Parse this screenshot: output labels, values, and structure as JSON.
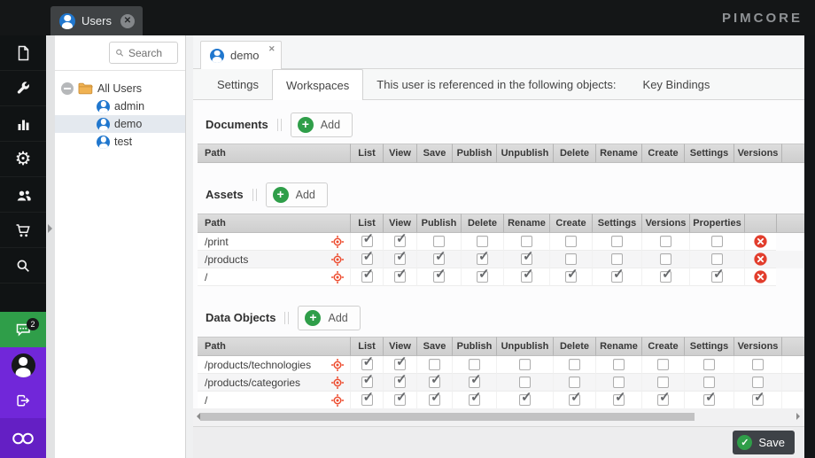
{
  "topbar": {
    "window_tab": {
      "label": "Users"
    },
    "logo_text": "PIMCORE"
  },
  "sidebar": {
    "top_items": [
      {
        "name": "documents",
        "icon": "file-icon"
      },
      {
        "name": "tools",
        "icon": "wrench-icon"
      },
      {
        "name": "reports",
        "icon": "bar-chart-icon"
      },
      {
        "name": "settings",
        "icon": "gear-icon"
      },
      {
        "name": "users",
        "icon": "users-icon"
      },
      {
        "name": "ecommerce",
        "icon": "cart-icon"
      },
      {
        "name": "search",
        "icon": "search-icon"
      }
    ],
    "bottom_items": [
      {
        "name": "notifications",
        "icon": "chat-icon",
        "badge": "2",
        "color": "#2f9e49"
      },
      {
        "name": "account",
        "icon": "user-icon",
        "color": "#7127d9"
      },
      {
        "name": "logout",
        "icon": "logout-icon",
        "color": "#7127d9"
      },
      {
        "name": "pimcore",
        "icon": "infinity-icon",
        "color": "#641fc4"
      }
    ]
  },
  "tree": {
    "search_placeholder": "Search",
    "root_label": "All Users",
    "users": [
      "admin",
      "demo",
      "test"
    ],
    "selected_user": "demo"
  },
  "main": {
    "object_tab": {
      "label": "demo"
    },
    "subtabs": [
      {
        "label": "Settings",
        "active": false
      },
      {
        "label": "Workspaces",
        "active": true
      },
      {
        "label": "This user is referenced in the following objects:",
        "active": false
      },
      {
        "label": "Key Bindings",
        "active": false
      }
    ],
    "sections": [
      {
        "title": "Documents",
        "add_label": "Add",
        "columns": [
          "Path",
          "List",
          "View",
          "Save",
          "Publish",
          "Unpublish",
          "Delete",
          "Rename",
          "Create",
          "Settings",
          "Versions"
        ],
        "row_delete_button": false,
        "rows": []
      },
      {
        "title": "Assets",
        "add_label": "Add",
        "columns": [
          "Path",
          "List",
          "View",
          "Publish",
          "Delete",
          "Rename",
          "Create",
          "Settings",
          "Versions",
          "Properties"
        ],
        "row_delete_button": true,
        "rows": [
          {
            "path": "/print",
            "checks": [
              true,
              true,
              false,
              false,
              false,
              false,
              false,
              false,
              false
            ]
          },
          {
            "path": "/products",
            "checks": [
              true,
              true,
              true,
              true,
              true,
              false,
              false,
              false,
              false
            ]
          },
          {
            "path": "/",
            "checks": [
              true,
              true,
              true,
              true,
              true,
              true,
              true,
              true,
              true
            ]
          }
        ]
      },
      {
        "title": "Data Objects",
        "add_label": "Add",
        "columns": [
          "Path",
          "List",
          "View",
          "Save",
          "Publish",
          "Unpublish",
          "Delete",
          "Rename",
          "Create",
          "Settings",
          "Versions"
        ],
        "row_delete_button": false,
        "rows": [
          {
            "path": "/products/technologies",
            "checks": [
              true,
              true,
              false,
              false,
              false,
              false,
              false,
              false,
              false,
              false
            ]
          },
          {
            "path": "/products/categories",
            "checks": [
              true,
              true,
              true,
              true,
              false,
              false,
              false,
              false,
              false,
              false
            ]
          },
          {
            "path": "/",
            "checks": [
              true,
              true,
              true,
              true,
              true,
              true,
              true,
              true,
              true,
              true
            ]
          }
        ]
      }
    ]
  },
  "footer": {
    "save_label": "Save"
  },
  "colors": {
    "accent_green": "#2f9e49",
    "accent_purple": "#7127d9",
    "danger_red": "#e23e2d",
    "selection_blue": "#2077ce"
  }
}
